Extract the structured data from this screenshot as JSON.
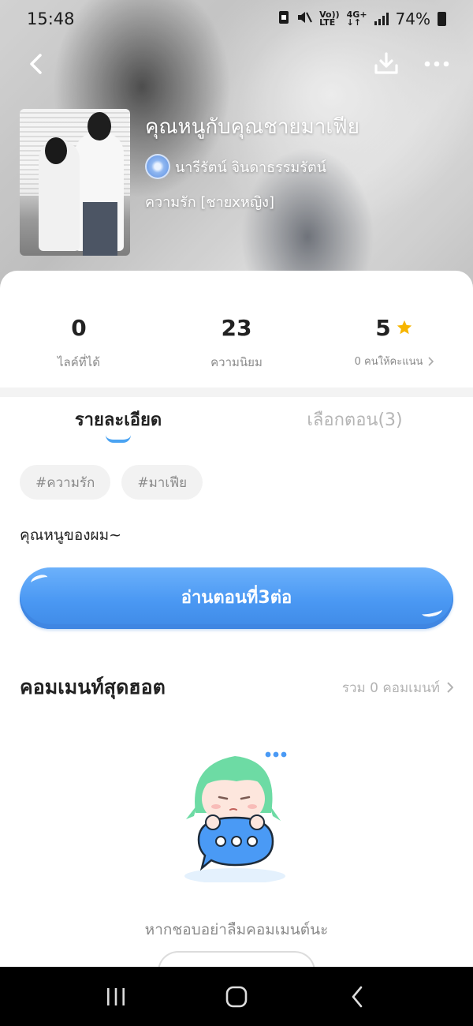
{
  "status_bar": {
    "time": "15:48",
    "network_top": "Vo))",
    "network_bottom": "LTE",
    "signal_type_top": "4G+",
    "signal_type_bottom": "↓↑",
    "battery": "74%"
  },
  "header": {
    "back_icon": "chevron-left-icon",
    "download_icon": "download-icon",
    "more_icon": "more-dots-icon"
  },
  "story": {
    "title": "คุณหนูกับคุณชายมาเฟีย",
    "author": "นารีรัตน์ จินดาธรรมรัตน์",
    "genre": "ความรัก [ชายxหญิง]"
  },
  "stats": [
    {
      "value": "0",
      "label": "ไลค์ที่ได้"
    },
    {
      "value": "23",
      "label": "ความนิยม"
    },
    {
      "value": "5",
      "label": "0 คนให้คะแนน",
      "icon": "star-icon",
      "icon_color": "#f7b500"
    }
  ],
  "tabs": [
    {
      "label": "รายละเอียด",
      "active": true
    },
    {
      "label": "เลือกตอน(3)",
      "active": false
    }
  ],
  "tags": [
    "#ความรัก",
    "#มาเฟีย"
  ],
  "description": "คุณหนูของผม~",
  "read_button": {
    "label": "อ่านตอนที่3ต่อ"
  },
  "comments": {
    "title": "คอมเมนท์สุดฮอต",
    "count_label": "รวม 0 คอมเมนท์",
    "empty_text": "หากชอบอย่าลืมคอมเมนต์นะ"
  },
  "colors": {
    "accent": "#4a98f3",
    "tab_indicator": "#4aa3f2",
    "mascot_hair": "#6ddba4",
    "mascot_bubble": "#4a9af5"
  }
}
